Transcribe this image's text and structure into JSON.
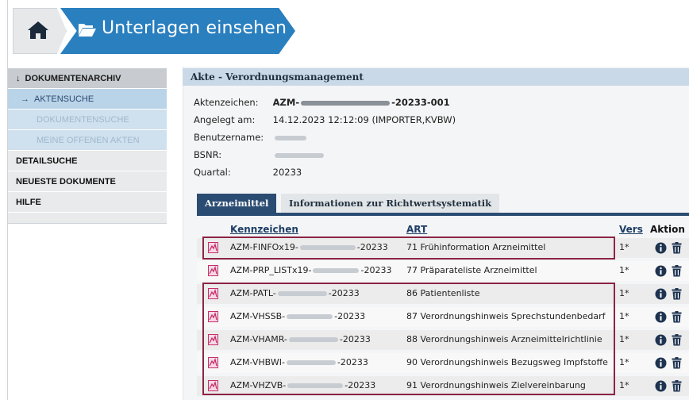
{
  "header": {
    "title": "Unterlagen einsehen"
  },
  "sidebar": {
    "items": [
      {
        "label": "DOKUMENTENARCHIV",
        "arrow": "↓"
      },
      {
        "label": "AKTENSUCHE",
        "arrow": "→"
      },
      {
        "label": "DOKUMENTENSUCHE"
      },
      {
        "label": "MEINE OFFENEN AKTEN"
      },
      {
        "label": "DETAILSUCHE"
      },
      {
        "label": "NEUESTE DOKUMENTE"
      },
      {
        "label": "HILFE"
      }
    ]
  },
  "panel": {
    "title": "Akte - Verordnungsmanagement",
    "meta": {
      "aktenzeichen_label": "Aktenzeichen:",
      "aktenzeichen_prefix": "AZM-",
      "aktenzeichen_suffix": "-20233-001",
      "angelegt_label": "Angelegt am:",
      "angelegt_value": "14.12.2023 12:12:09 (IMPORTER,KVBW)",
      "benutzer_label": "Benutzername:",
      "bsnr_label": "BSNR:",
      "quartal_label": "Quartal:",
      "quartal_value": "20233"
    },
    "tabs": [
      "Arzneimittel",
      "Informationen zur Richtwertsystematik"
    ],
    "table": {
      "headers": {
        "kennzeichen": "Kennzeichen",
        "art": "ART",
        "vers": "Vers",
        "aktion": "Aktion"
      },
      "rows": [
        {
          "prefix": "AZM-FINFOx19-",
          "suffix": "-20233",
          "art": "71 Frühinformation Arzneimittel",
          "vers": "1*"
        },
        {
          "prefix": "AZM-PRP_LISTx19-",
          "suffix": "-20233",
          "art": "77 Präparateliste Arzneimittel",
          "vers": "1*"
        },
        {
          "prefix": "AZM-PATL-",
          "suffix": "-20233",
          "art": "86 Patientenliste",
          "vers": "1*"
        },
        {
          "prefix": "AZM-VHSSB-",
          "suffix": "-20233",
          "art": "87 Verordnungshinweis Sprechstundenbedarf",
          "vers": "1*"
        },
        {
          "prefix": "AZM-VHAMR-",
          "suffix": "-20233",
          "art": "88 Verordnungshinweis Arzneimittelrichtlinie",
          "vers": "1*"
        },
        {
          "prefix": "AZM-VHBWI-",
          "suffix": "-20233",
          "art": "90 Verordnungshinweis Bezugsweg Impfstoffe",
          "vers": "1*"
        },
        {
          "prefix": "AZM-VHZVB-",
          "suffix": "-20233",
          "art": "91 Verordnungshinweis Zielvereinbarung",
          "vers": "1*"
        }
      ]
    }
  },
  "colors": {
    "accent": "#2a7fbf",
    "navy": "#2b4c72",
    "highlight": "#8c2444",
    "doc_icon": "#c4306a"
  },
  "icons": [
    "home-icon",
    "folder-open-icon",
    "document-icon",
    "info-icon",
    "trash-icon"
  ]
}
